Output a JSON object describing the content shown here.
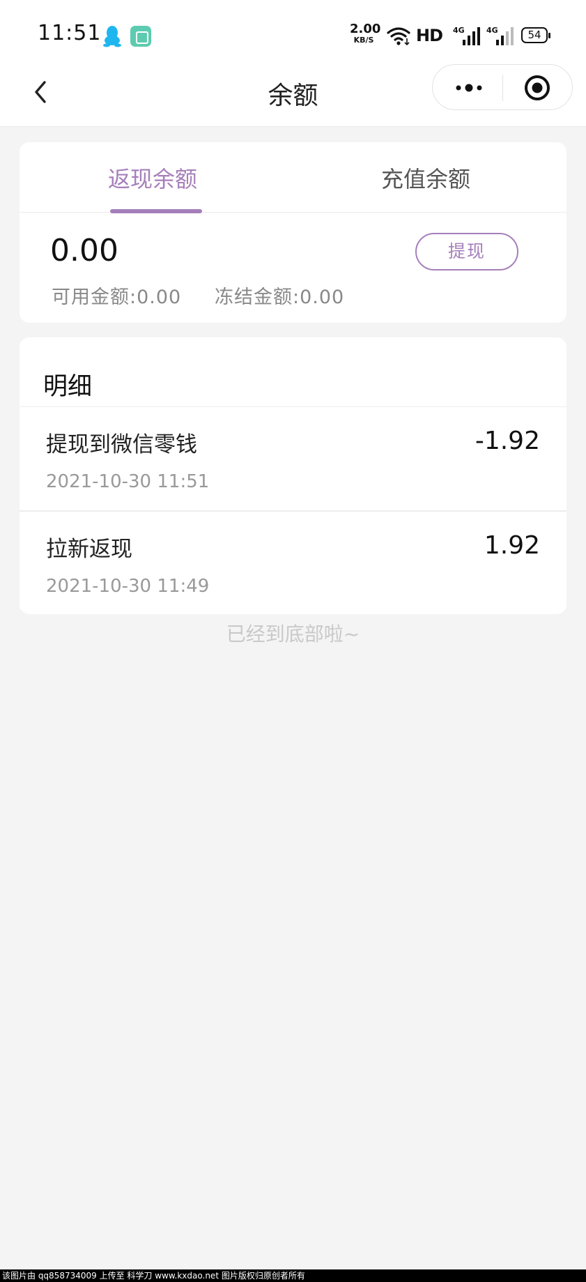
{
  "status_bar": {
    "time": "11:51",
    "speed_value": "2.00",
    "speed_unit": "KB/S",
    "hd": "HD",
    "signal_1": "4G",
    "signal_2": "4G",
    "battery": "54",
    "icons": [
      "qq-icon",
      "app-icon",
      "wifi-icon",
      "signal-icon",
      "battery-icon"
    ]
  },
  "nav": {
    "title": "余额",
    "icons": [
      "back-icon",
      "more-icon",
      "target-icon"
    ]
  },
  "balance": {
    "tabs": [
      {
        "label": "返现余额",
        "active": true
      },
      {
        "label": "充值余额",
        "active": false
      }
    ],
    "amount": "0.00",
    "available": "可用金额:0.00",
    "frozen": "冻结金额:0.00",
    "withdraw_label": "提现"
  },
  "details": {
    "title": "明细",
    "items": [
      {
        "title": "提现到微信零钱",
        "amount": "-1.92",
        "time": "2021-10-30 11:51"
      },
      {
        "title": "拉新返现",
        "amount": "1.92",
        "time": "2021-10-30 11:49"
      }
    ],
    "end_note": "已经到底部啦~"
  },
  "watermark": "该图片由 qq858734009 上传至 科学刀 www.kxdao.net 图片版权归原创者所有",
  "colors": {
    "accent": "#a67fba",
    "background": "#f4f4f4",
    "card": "#ffffff",
    "muted_text": "#999999"
  }
}
